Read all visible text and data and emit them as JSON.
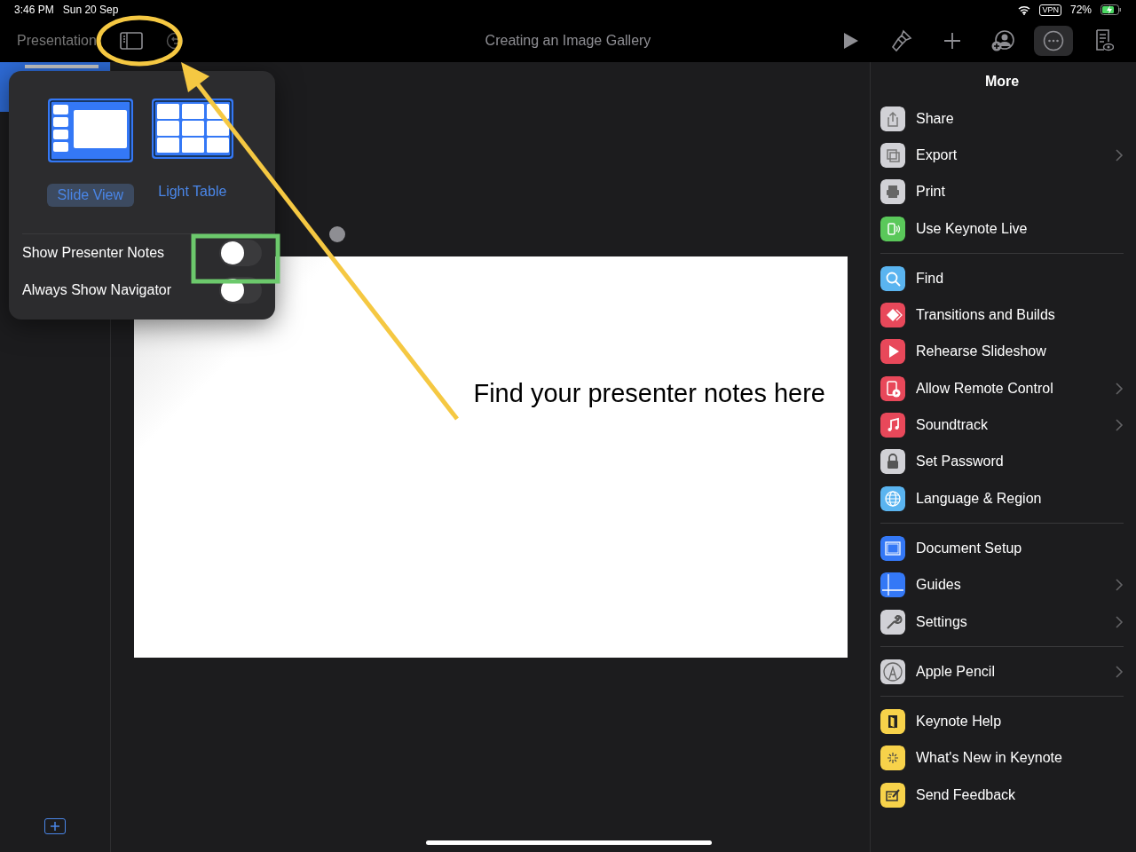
{
  "status_bar": {
    "time": "3:46 PM",
    "date": "Sun 20 Sep",
    "vpn": "VPN",
    "battery": "72%"
  },
  "toolbar": {
    "back_label": "Presentation",
    "title": "Creating an Image Gallery",
    "more_active": true
  },
  "view_popover": {
    "views": [
      {
        "label": "Slide View",
        "selected": true
      },
      {
        "label": "Light Table",
        "selected": false
      }
    ],
    "toggles": [
      {
        "label": "Show Presenter Notes",
        "on": false
      },
      {
        "label": "Always Show Navigator",
        "on": false
      }
    ]
  },
  "slide": {
    "text": "Find your presenter notes here"
  },
  "more_menu": {
    "title": "More",
    "sections": [
      [
        {
          "label": "Share",
          "color": "#d1d1d6",
          "has_submenu": false
        },
        {
          "label": "Export",
          "color": "#d1d1d6",
          "has_submenu": true
        },
        {
          "label": "Print",
          "color": "#d1d1d6",
          "has_submenu": false
        },
        {
          "label": "Use Keynote Live",
          "color": "#5ac85a",
          "has_submenu": false
        }
      ],
      [
        {
          "label": "Find",
          "color": "#5ab4f0",
          "has_submenu": false
        },
        {
          "label": "Transitions and Builds",
          "color": "#e8485a",
          "has_submenu": false
        },
        {
          "label": "Rehearse Slideshow",
          "color": "#e8485a",
          "has_submenu": false
        },
        {
          "label": "Allow Remote Control",
          "color": "#e8485a",
          "has_submenu": true
        },
        {
          "label": "Soundtrack",
          "color": "#e8485a",
          "has_submenu": true
        },
        {
          "label": "Set Password",
          "color": "#d1d1d6",
          "has_submenu": false
        },
        {
          "label": "Language & Region",
          "color": "#5ab4f0",
          "has_submenu": false
        }
      ],
      [
        {
          "label": "Document Setup",
          "color": "#3478f6",
          "has_submenu": false
        },
        {
          "label": "Guides",
          "color": "#3478f6",
          "has_submenu": true
        },
        {
          "label": "Settings",
          "color": "#d1d1d6",
          "has_submenu": true
        }
      ],
      [
        {
          "label": "Apple Pencil",
          "color": "#d1d1d6",
          "has_submenu": true
        }
      ],
      [
        {
          "label": "Keynote Help",
          "color": "#f7d24a",
          "has_submenu": false
        },
        {
          "label": "What's New in Keynote",
          "color": "#f7d24a",
          "has_submenu": false
        },
        {
          "label": "Send Feedback",
          "color": "#f7d24a",
          "has_submenu": false
        }
      ]
    ]
  }
}
